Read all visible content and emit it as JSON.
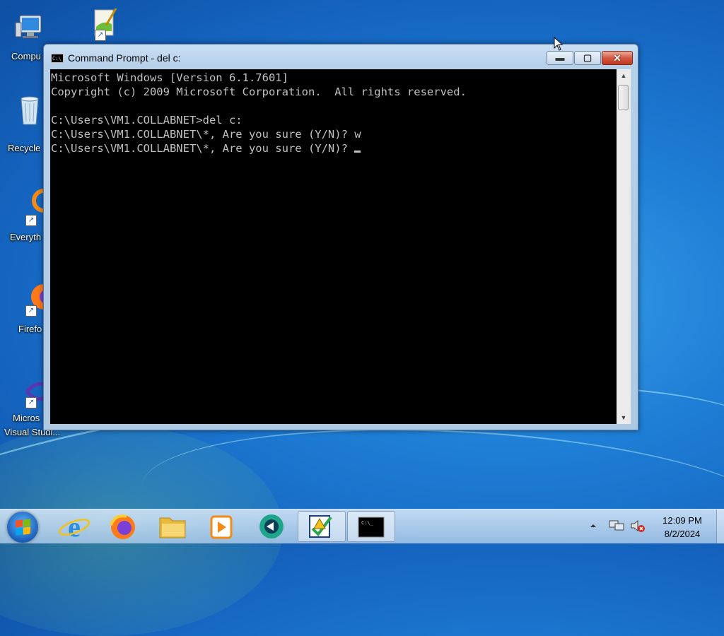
{
  "desktop": {
    "icons": [
      {
        "label": "Compu",
        "icon": "computer-icon"
      },
      {
        "label": "",
        "icon": "notepad-plus-plus-icon"
      },
      {
        "label": "Recycle",
        "icon": "recycle-bin-icon"
      },
      {
        "label": "Everyth",
        "icon": "everything-search-icon"
      },
      {
        "label": "Firefo",
        "icon": "firefox-icon"
      },
      {
        "label": "Micros",
        "label2": "Visual Studi...",
        "icon": "visual-studio-icon"
      }
    ]
  },
  "window": {
    "title": "Command Prompt - del  c:",
    "icon": "cmd-icon",
    "minimize_label": "▬",
    "maximize_label": "▢",
    "close_label": "✕"
  },
  "console": {
    "lines": [
      "Microsoft Windows [Version 6.1.7601]",
      "Copyright (c) 2009 Microsoft Corporation.  All rights reserved.",
      "",
      "C:\\Users\\VM1.COLLABNET>del c:",
      "C:\\Users\\VM1.COLLABNET\\*, Are you sure (Y/N)? w",
      "C:\\Users\\VM1.COLLABNET\\*, Are you sure (Y/N)? "
    ],
    "colors": {
      "background": "#000000",
      "text": "#c0c0c0"
    }
  },
  "taskbar": {
    "items": [
      {
        "name": "internet-explorer",
        "icon": "internet-explorer-icon"
      },
      {
        "name": "firefox",
        "icon": "firefox-icon"
      },
      {
        "name": "file-explorer",
        "icon": "folder-icon"
      },
      {
        "name": "media-player",
        "icon": "media-player-icon"
      },
      {
        "name": "app-green",
        "icon": "green-circle-app-icon"
      },
      {
        "name": "task-app",
        "icon": "checklist-warning-icon"
      },
      {
        "name": "command-prompt",
        "icon": "cmd-icon",
        "active": true
      }
    ],
    "tray": {
      "arrow_icon": "show-hidden-icons-arrow",
      "network_icon": "network-icon",
      "volume_icon": "volume-muted-icon"
    },
    "clock": {
      "time": "12:09 PM",
      "date": "8/2/2024"
    }
  }
}
